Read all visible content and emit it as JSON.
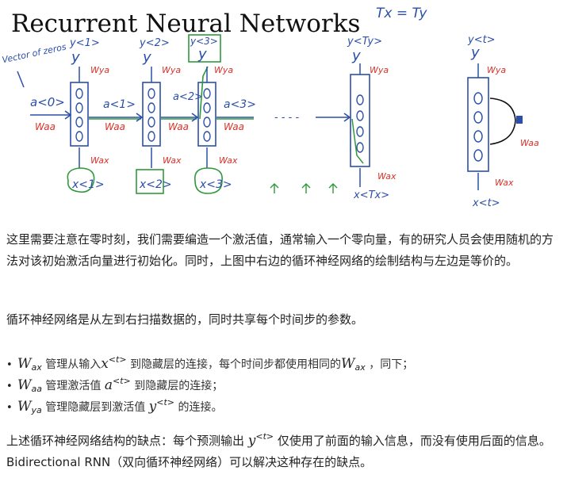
{
  "figure": {
    "title": "Recurrent Neural Networks",
    "formula_note": "Tx = Ty",
    "vector_note": "Vector of zeros",
    "a0": "a<0>",
    "a1": "a<1>",
    "a2": "a<2>",
    "a3": "a<3>",
    "dots": "- - - -",
    "y1": "y<1>",
    "y2": "y<2>",
    "y3": "y<3>",
    "yTy": "y<Ty>",
    "yt": "y<t>",
    "x1": "x<1>",
    "x2": "x<2>",
    "x3": "x<3>",
    "xTx": "x<Tx>",
    "xt": "x<t>",
    "wya": "Wya",
    "waa": "Waa",
    "wax": "Wax",
    "colors": {
      "ink_blue": "#2b4fa8",
      "ink_red": "#d9322b",
      "ink_green": "#2e9a3a"
    }
  },
  "text": {
    "p1": "这里需要注意在零时刻，我们需要编造一个激活值，通常输入一个零向量，有的研究人员会使用随机的方法对该初始激活向量进行初始化。同时，上图中右边的循环神经网络的绘制结构与左边是等价的。",
    "p2": "循环神经网络是从左到右扫描数据的，同时共享每个时间步的参数。",
    "bullet_mark": "•",
    "b1": {
      "w": "W",
      "w_sub": "ax",
      "t1": " 管理从输入",
      "x": "x",
      "x_sup": "<t>",
      "t2": " 到隐藏层的连接，每个时间步都使用相同的",
      "w2": "W",
      "w2_sub": "ax",
      "t3": " ，同下；"
    },
    "b2": {
      "w": "W",
      "w_sub": "aa",
      "t1": " 管理激活值 ",
      "a": "a",
      "a_sup": "<t>",
      "t2": " 到隐藏层的连接；"
    },
    "b3": {
      "w": "W",
      "w_sub": "ya",
      "t1": " 管理隐藏层到激活值 ",
      "y": "y",
      "y_sup": "<t>",
      "t2": " 的连接。"
    },
    "p3a": "上述循环神经网络结构的缺点：每个预测输出 ",
    "p3_y": "y",
    "p3_sup": "<t>",
    "p3b": " 仅使用了前面的输入信息，而没有使用后面的信息。Bidirectional RNN（双向循环神经网络）可以解决这种存在的缺点。"
  }
}
